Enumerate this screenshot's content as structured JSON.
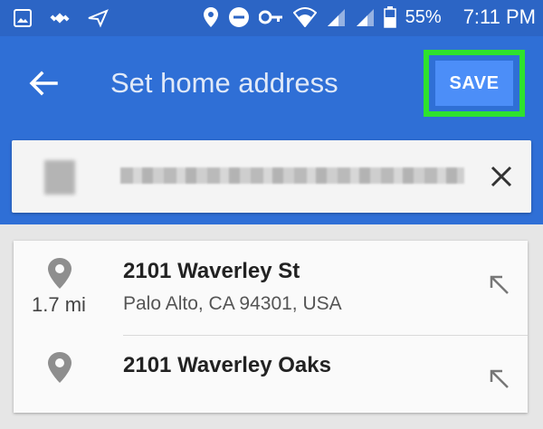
{
  "status_bar": {
    "battery_percent": "55%",
    "time": "7:11 PM",
    "left_icons": [
      "image-icon",
      "satellite-icon",
      "send-icon"
    ],
    "right_icons": [
      "location-icon",
      "do-not-disturb-icon",
      "key-icon",
      "wifi-icon",
      "signal-icon",
      "signal-icon",
      "battery-icon"
    ]
  },
  "app_bar": {
    "title": "Set home address",
    "save_label": "SAVE",
    "back_icon": "arrow-back-icon"
  },
  "search": {
    "clear_icon": "close-icon"
  },
  "results": [
    {
      "street_number": "2101",
      "street_name": "Waverley St",
      "address_line2": "Palo Alto, CA 94301, USA",
      "distance": "1.7 mi"
    },
    {
      "street_number": "2101",
      "street_name": "Waverley Oaks",
      "address_line2": "",
      "distance": ""
    }
  ],
  "colors": {
    "app_bar": "#2f6fd6",
    "status_bar": "#2c65c5",
    "save_button": "#4c8ef8",
    "highlight": "#2ee22e"
  }
}
